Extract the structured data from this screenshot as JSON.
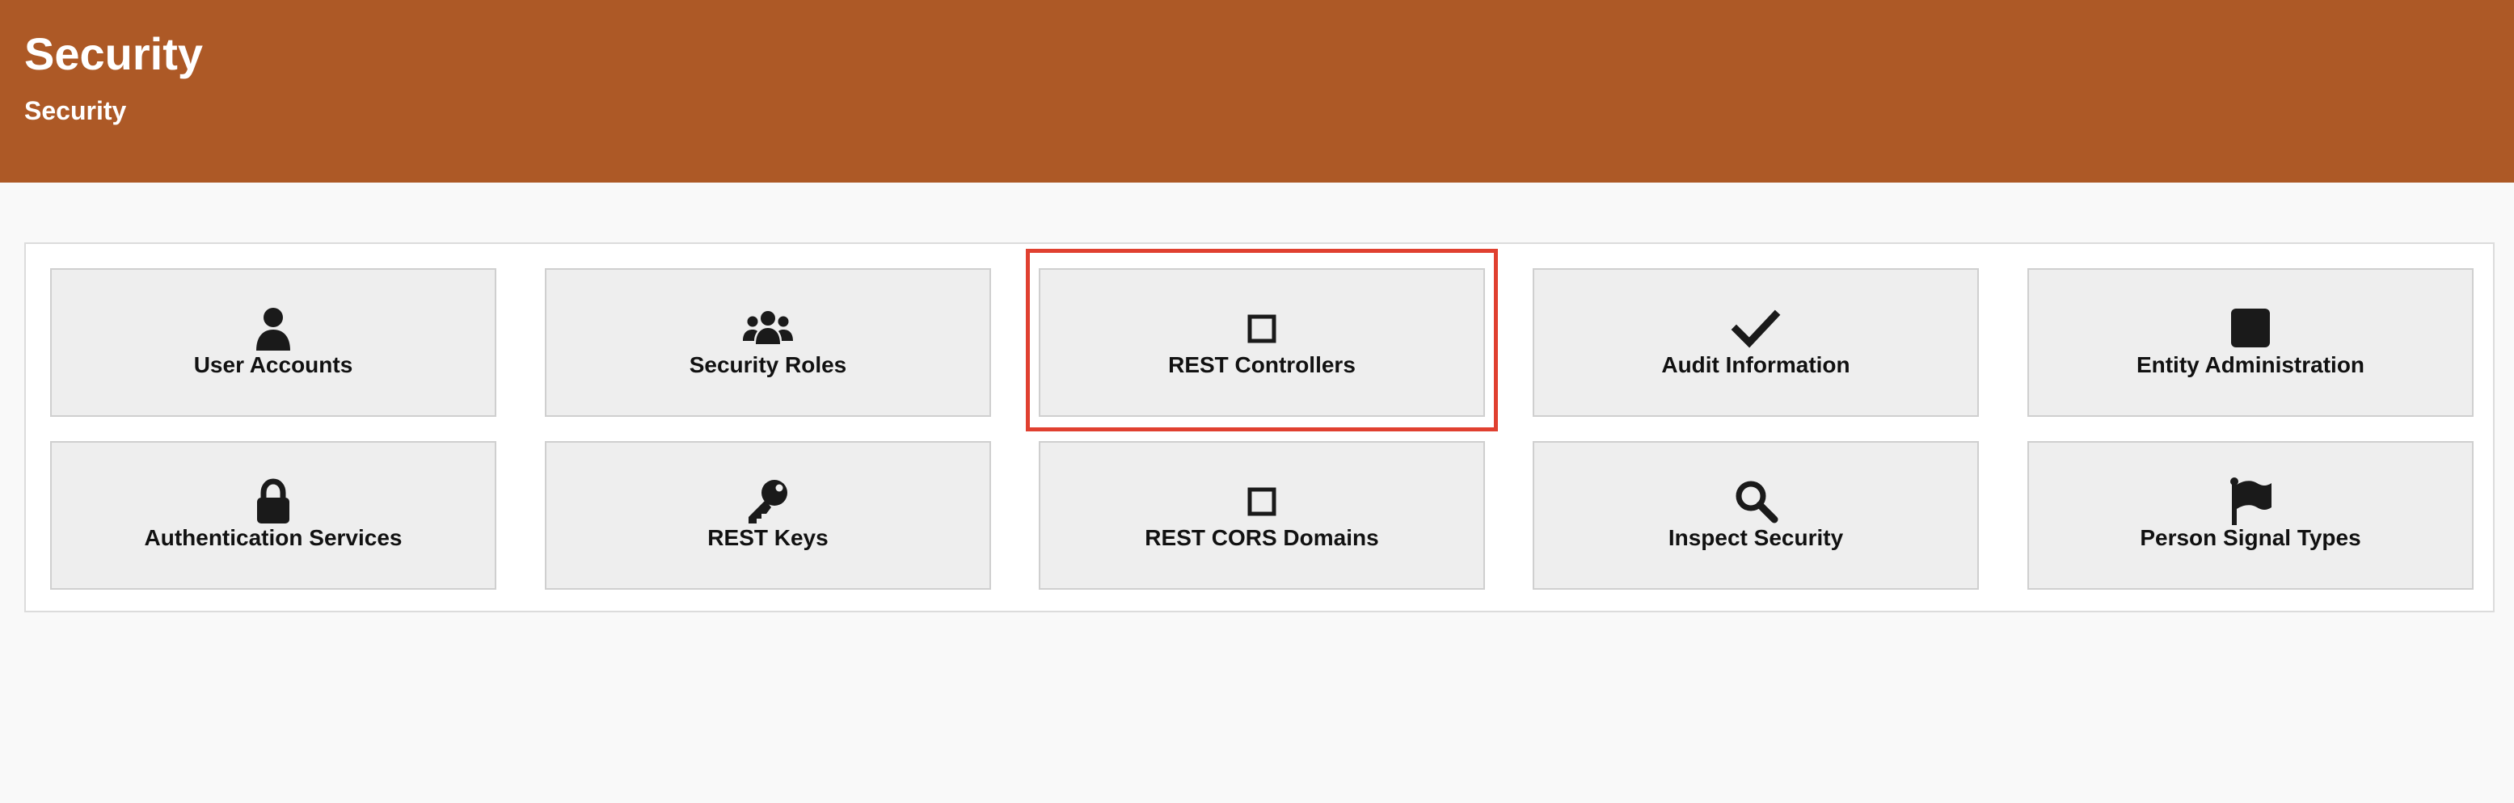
{
  "header": {
    "title": "Security",
    "subtitle": "Security"
  },
  "tiles": [
    {
      "label": "User Accounts",
      "icon": "user-icon"
    },
    {
      "label": "Security Roles",
      "icon": "users-group-icon"
    },
    {
      "label": "REST Controllers",
      "icon": "square-outline-icon"
    },
    {
      "label": "Audit Information",
      "icon": "checkmark-icon"
    },
    {
      "label": "Entity Administration",
      "icon": "filled-square-icon"
    },
    {
      "label": "Authentication Services",
      "icon": "lock-icon"
    },
    {
      "label": "REST Keys",
      "icon": "key-icon"
    },
    {
      "label": "REST CORS Domains",
      "icon": "square-outline-icon"
    },
    {
      "label": "Inspect Security",
      "icon": "magnifier-icon"
    },
    {
      "label": "Person Signal Types",
      "icon": "flag-icon"
    }
  ],
  "colors": {
    "header_bg": "#ad5926",
    "highlight": "#e04030",
    "tile_bg": "#eeeeee"
  },
  "highlighted_tile": "REST Controllers"
}
